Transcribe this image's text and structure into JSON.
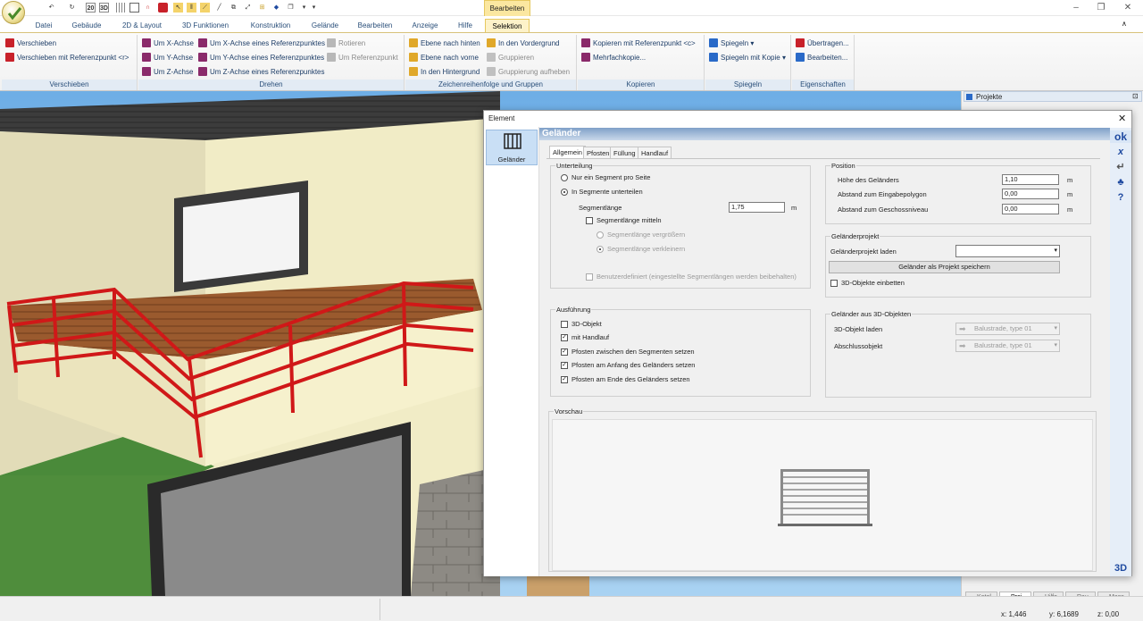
{
  "titlebar": {
    "quick_access": [
      "20",
      "3D"
    ],
    "context_tab_header": "Bearbeiten",
    "window_controls": [
      "–",
      "❐",
      "✕"
    ]
  },
  "tabs": [
    "Datei",
    "Gebäude",
    "2D & Layout",
    "3D Funktionen",
    "Konstruktion",
    "Gelände",
    "Bearbeiten",
    "Anzeige",
    "Hilfe",
    "Selektion"
  ],
  "active_tab": "Selektion",
  "ribbon": {
    "groups": {
      "verschieben": "Verschieben",
      "drehen": "Drehen",
      "zeichen": "Zeichenreihenfolge und Gruppen",
      "kopieren": "Kopieren",
      "spiegeln": "Spiegeln",
      "eigenschaften": "Eigenschaften"
    },
    "btn": {
      "verschieben": "Verschieben",
      "verschieben_ref": "Verschieben mit Referenzpunkt <r>",
      "um_x": "Um X-Achse",
      "um_y": "Um Y-Achse",
      "um_z": "Um Z-Achse",
      "um_x_ref": "Um X-Achse eines Referenzpunktes",
      "um_y_ref": "Um Y-Achse eines Referenzpunktes",
      "um_z_ref": "Um Z-Achse eines Referenzpunktes",
      "rotieren": "Rotieren",
      "um_ref": "Um Referenzpunkt",
      "ebene_hinten": "Ebene nach hinten",
      "ebene_vorne": "Ebene nach vorne",
      "hintergrund": "In den Hintergrund",
      "vordergrund": "In den Vordergrund",
      "gruppieren": "Gruppieren",
      "gruppierung_auf": "Gruppierung aufheben",
      "kopieren_ref": "Kopieren mit Referenzpunkt <c>",
      "mehrfach": "Mehrfachkopie...",
      "spiegeln": "Spiegeln",
      "spiegeln_kopie": "Spiegeln mit Kopie",
      "uebertragen": "Übertragen...",
      "bearbeiten": "Bearbeiten..."
    }
  },
  "right_panel": {
    "title": "Projekte",
    "bottom_tabs": [
      "Katal...",
      "Proj...",
      "Hilfe",
      "Rau...",
      "Mass..."
    ]
  },
  "dialog": {
    "title": "Element",
    "category_label": "Geländer",
    "header": "Geländer",
    "toolbar": {
      "ok": "ok",
      "close": "x",
      "view3d": "3D"
    },
    "tabs": [
      "Allgemein",
      "Pfosten",
      "Füllung",
      "Handlauf"
    ],
    "unterteilung": {
      "title": "Unterteilung",
      "radio_single": "Nur ein Segment pro Seite",
      "radio_segments": "In Segmente unterteilen",
      "seglen_label": "Segmentlänge",
      "seglen_value": "1,75",
      "seglen_unit": "m",
      "mitteln": "Segmentlänge mitteln",
      "vergroessern": "Segmentlänge vergrößern",
      "verkleinern": "Segmentlänge verkleinern",
      "benutzer": "Benutzerdefiniert (eingestellte Segmentlängen werden beibehalten)"
    },
    "position": {
      "title": "Position",
      "hoehe_label": "Höhe des Geländers",
      "hoehe_value": "1,10",
      "abstand_poly_label": "Abstand zum Eingabepolygon",
      "abstand_poly_value": "0,00",
      "abstand_gesch_label": "Abstand zum Geschossniveau",
      "abstand_gesch_value": "0,00",
      "unit": "m"
    },
    "projekt": {
      "title": "Geländerprojekt",
      "laden_label": "Geländerprojekt laden",
      "save_button": "Geländer als Projekt speichern",
      "einbetten": "3D-Objekte einbetten"
    },
    "ausfuehrung": {
      "title": "Ausführung",
      "obj3d": "3D-Objekt",
      "handlauf": "mit Handlauf",
      "pf_zwischen": "Pfosten zwischen den Segmenten setzen",
      "pf_anfang": "Pfosten am Anfang des Geländers setzen",
      "pf_ende": "Pfosten am Ende des Geländers setzen"
    },
    "aus3d": {
      "title": "Geländer aus 3D-Objekten",
      "laden_label": "3D-Objekt laden",
      "laden_value": "Balustrade, type 01",
      "abschluss_label": "Abschlussobjekt",
      "abschluss_value": "Balustrade, type 01"
    },
    "vorschau": "Vorschau"
  },
  "status": {
    "x": "x: 1,446",
    "y": "y: 6,1689",
    "z": "z: 0,00"
  }
}
